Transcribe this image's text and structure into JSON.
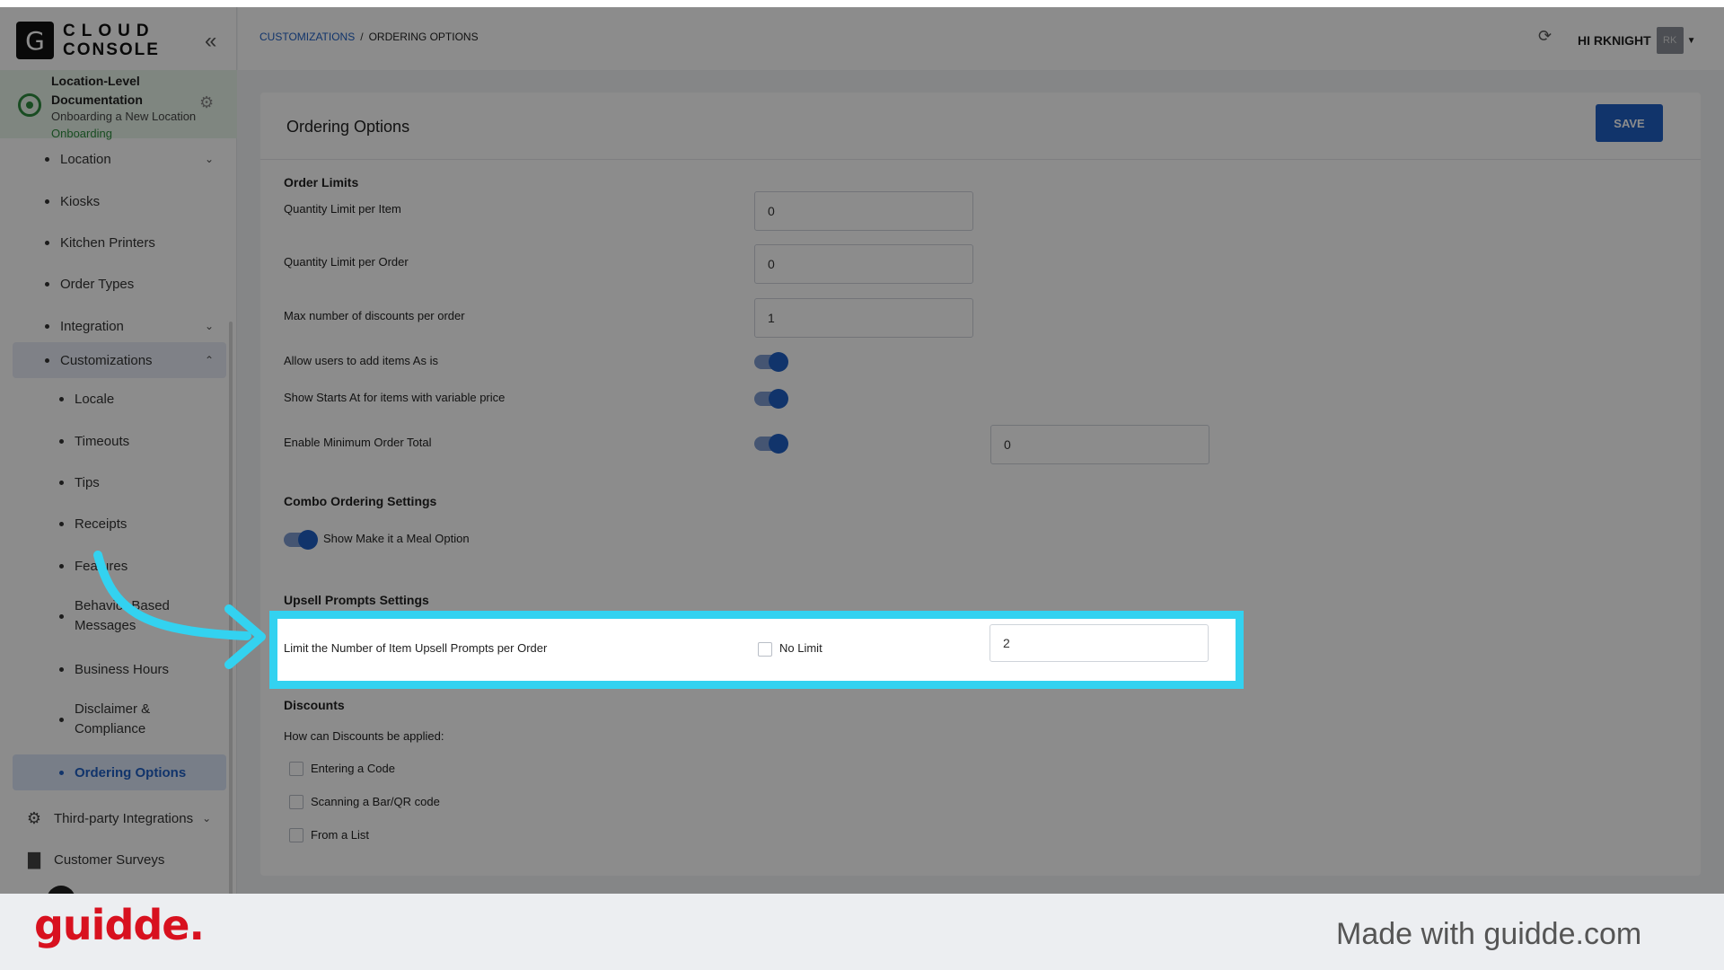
{
  "logo": {
    "letter": "G",
    "line1": "CLOUD",
    "line2": "CONSOLE"
  },
  "location": {
    "name": "Location-Level Documentation",
    "subtitle": "Onboarding a New Location",
    "status": "Onboarding"
  },
  "sidebar": {
    "items": [
      {
        "label": "Location",
        "chevron": "down"
      },
      {
        "label": "Kiosks"
      },
      {
        "label": "Kitchen Printers"
      },
      {
        "label": "Order Types"
      },
      {
        "label": "Integration",
        "chevron": "down"
      },
      {
        "label": "Customizations",
        "chevron": "up"
      }
    ],
    "sub_items": [
      {
        "label": "Locale"
      },
      {
        "label": "Timeouts"
      },
      {
        "label": "Tips"
      },
      {
        "label": "Receipts"
      },
      {
        "label": "Features"
      },
      {
        "label": "Behavior Based Messages"
      },
      {
        "label": "Business Hours"
      },
      {
        "label": "Disclaimer & Compliance"
      },
      {
        "label": "Ordering Options"
      }
    ],
    "bottom_items": [
      {
        "label": "Third-party Integrations",
        "icon": "gear-icon"
      },
      {
        "label": "Customer Surveys",
        "icon": "briefcase-icon"
      }
    ]
  },
  "header": {
    "breadcrumb_link": "CUSTOMIZATIONS",
    "breadcrumb_sep": "/",
    "breadcrumb_current": "ORDERING OPTIONS",
    "user_greeting": "HI RKNIGHT",
    "user_initials": "RK"
  },
  "page": {
    "title": "Ordering Options",
    "save_label": "SAVE",
    "order_limits": {
      "title": "Order Limits",
      "qty_item_label": "Quantity Limit per Item",
      "qty_item_value": "0",
      "qty_order_label": "Quantity Limit per Order",
      "qty_order_value": "0",
      "max_discounts_label": "Max number of discounts per order",
      "max_discounts_value": "1",
      "allow_as_is_label": "Allow users to add items As is",
      "allow_as_is_on": true,
      "starts_at_label": "Show Starts At for items with variable price",
      "starts_at_on": true,
      "min_total_label": "Enable Minimum Order Total",
      "min_total_on": true,
      "min_total_value": "0"
    },
    "combo": {
      "title": "Combo Ordering Settings",
      "meal_label": "Show Make it a Meal Option",
      "meal_on": true
    },
    "upsell": {
      "title": "Upsell Prompts Settings",
      "limit_label": "Limit the Number of Item Upsell Prompts per Order",
      "no_limit_label": "No Limit",
      "no_limit_checked": false,
      "limit_value": "2"
    },
    "discounts": {
      "title": "Discounts",
      "question": "How can Discounts be applied:",
      "options": [
        "Entering a Code",
        "Scanning a Bar/QR code",
        "From a List"
      ]
    }
  },
  "footer": {
    "brand": "guidde.",
    "made_with": "Made with guidde.com"
  },
  "colors": {
    "accent": "#1f5fc4",
    "highlight": "#33d2f0",
    "brand": "#d8111f",
    "status_green": "#2e8b3e"
  }
}
